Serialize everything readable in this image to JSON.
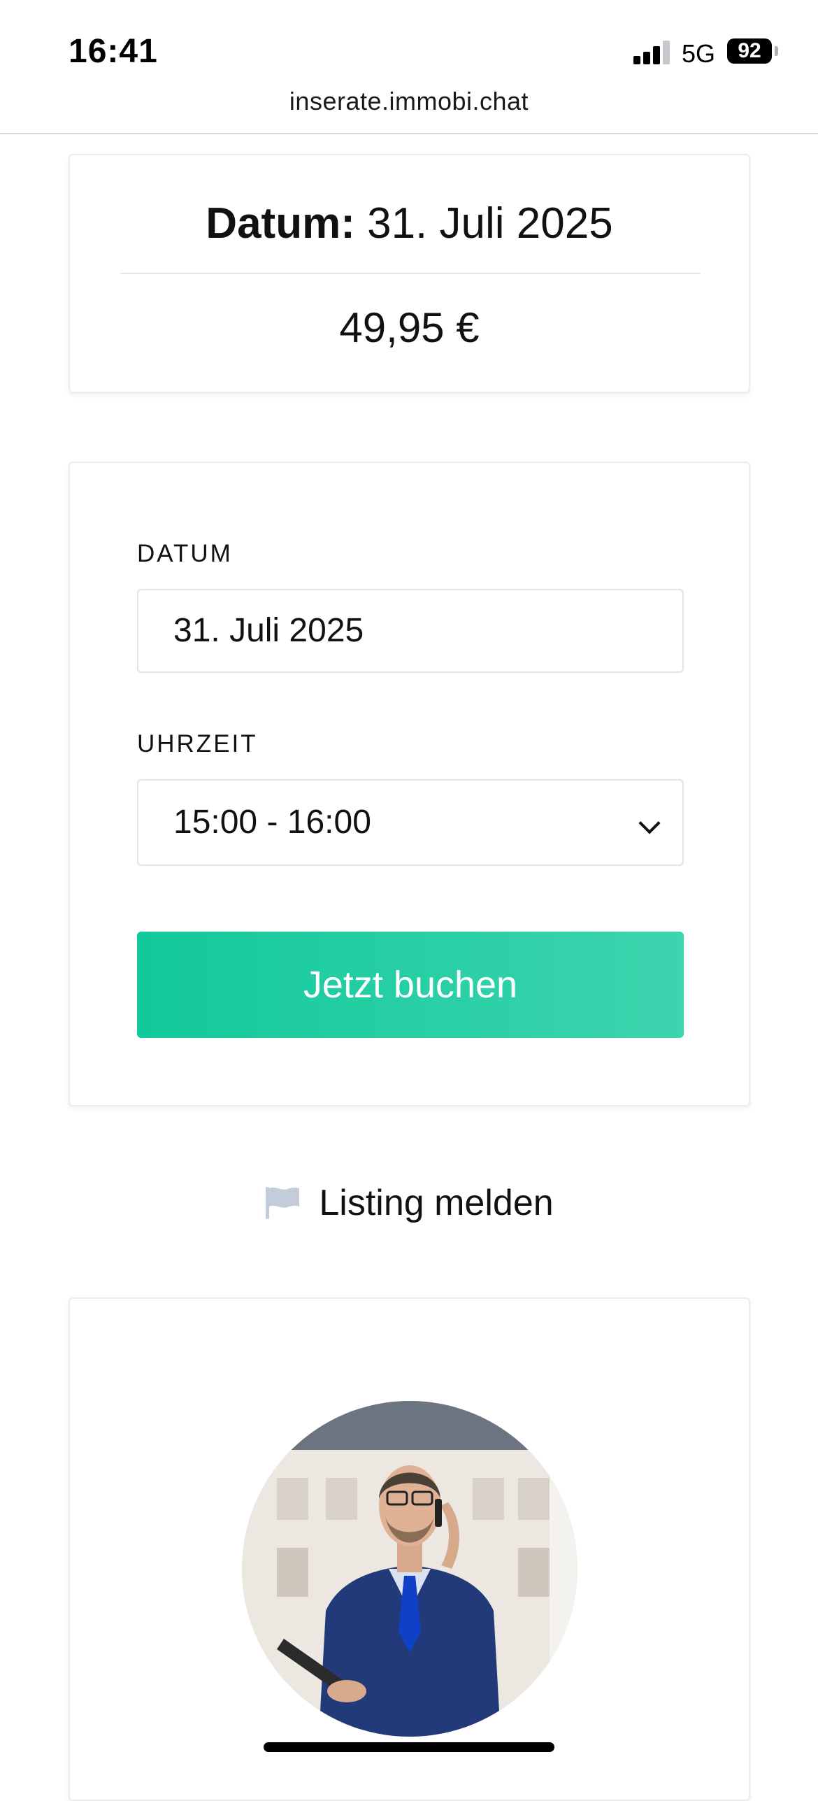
{
  "status_bar": {
    "time": "16:41",
    "network": "5G",
    "battery": "92",
    "signal_icon": "cellular-signal-icon",
    "battery_icon": "battery-icon"
  },
  "browser": {
    "url": "inserate.immobi.chat"
  },
  "price_card": {
    "date_label": "Datum:",
    "date_value": "31. Juli 2025",
    "price": "49,95 €"
  },
  "booking_form": {
    "date_label": "DATUM",
    "date_value": "31. Juli 2025",
    "time_label": "UHRZEIT",
    "time_value": "15:00 - 16:00",
    "select_icon": "chevron-down-icon",
    "submit_label": "Jetzt buchen",
    "button_gradient": [
      "#12c99b",
      "#3dd4ae"
    ]
  },
  "report": {
    "icon": "flag-icon",
    "label": "Listing melden",
    "icon_color": "#c3ccd8"
  },
  "agent_card": {
    "avatar": "agent-photo"
  }
}
